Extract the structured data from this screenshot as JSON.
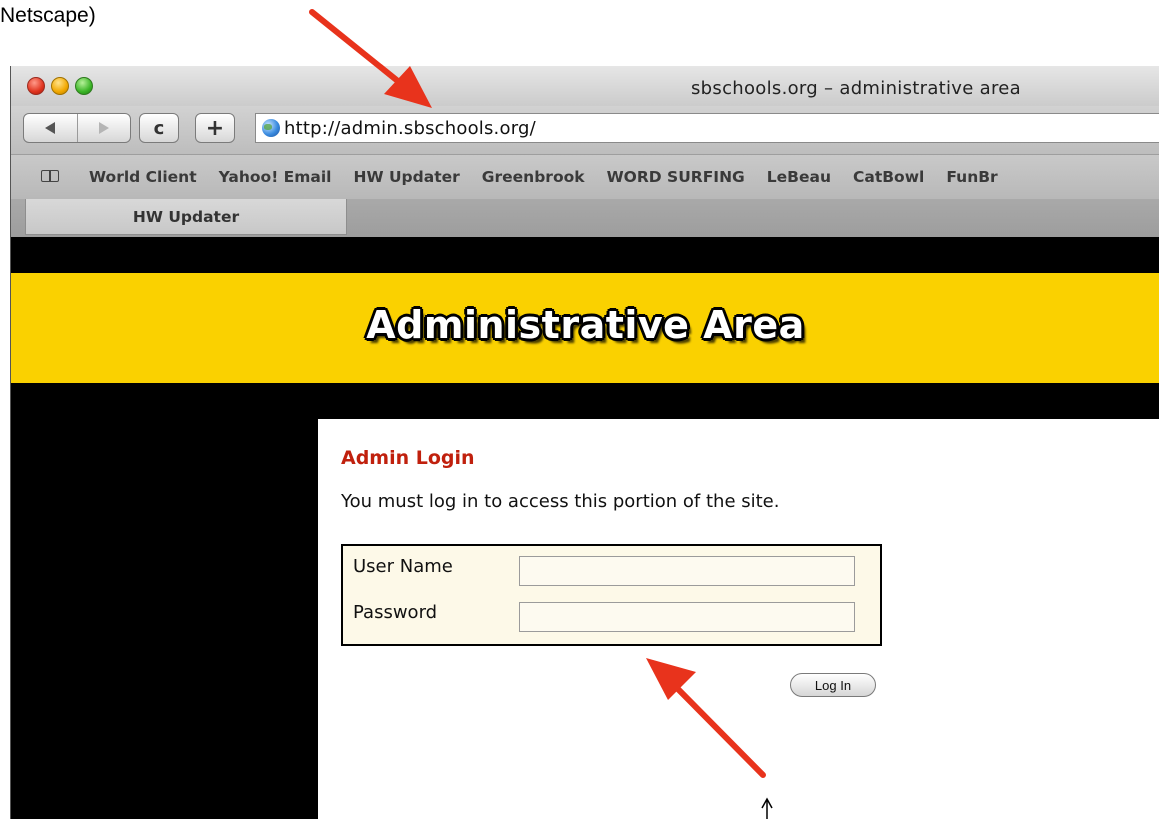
{
  "caption": "Netscape)",
  "window": {
    "title": "sbschools.org – administrative area"
  },
  "toolbar": {
    "address_url": "http://admin.sbschools.org/",
    "reload_glyph": "c",
    "add_glyph": "+"
  },
  "bookmarks_bar": {
    "items": [
      "World Client",
      "Yahoo! Email",
      "HW Updater",
      "Greenbrook",
      "WORD SURFING",
      "LeBeau",
      "CatBowl",
      "FunBr"
    ]
  },
  "tabs": [
    {
      "label": "HW Updater"
    }
  ],
  "page": {
    "banner_title": "Administrative Area",
    "login": {
      "heading": "Admin Login",
      "message": "You must log in to access this portion of the site.",
      "username_label": "User Name",
      "password_label": "Password",
      "username_value": "",
      "password_value": "",
      "submit_label": "Log In"
    }
  },
  "colors": {
    "banner": "#fad100",
    "heading": "#c0200d",
    "arrow": "#e8331c",
    "login_box_bg": "#fdf9e8"
  },
  "icons": [
    "back-arrow-icon",
    "forward-arrow-icon",
    "reload-icon",
    "add-icon",
    "globe-icon",
    "bookmarks-book-icon"
  ]
}
